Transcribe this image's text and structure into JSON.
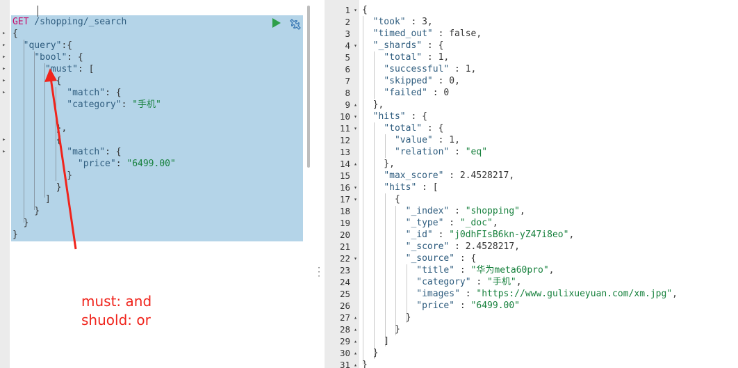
{
  "request": {
    "method": "GET",
    "url": " /shopping/_search",
    "lines": [
      [
        {
          "t": "p",
          "v": "{"
        }
      ],
      [
        {
          "t": "p",
          "v": "  "
        },
        {
          "t": "k",
          "v": "\"query\""
        },
        {
          "t": "p",
          "v": ":{"
        }
      ],
      [
        {
          "t": "p",
          "v": "    "
        },
        {
          "t": "k",
          "v": "\"bool\""
        },
        {
          "t": "p",
          "v": ": {"
        }
      ],
      [
        {
          "t": "p",
          "v": "      "
        },
        {
          "t": "k",
          "v": "\"must\""
        },
        {
          "t": "p",
          "v": ": ["
        }
      ],
      [
        {
          "t": "p",
          "v": "        {"
        }
      ],
      [
        {
          "t": "p",
          "v": "          "
        },
        {
          "t": "k",
          "v": "\"match\""
        },
        {
          "t": "p",
          "v": ": {"
        }
      ],
      [
        {
          "t": "p",
          "v": "          "
        },
        {
          "t": "k",
          "v": "\"category\""
        },
        {
          "t": "p",
          "v": ": "
        },
        {
          "t": "s",
          "v": "\"手机\""
        }
      ],
      [
        {
          "t": "p",
          "v": ""
        }
      ],
      [
        {
          "t": "p",
          "v": "        },"
        }
      ],
      [
        {
          "t": "p",
          "v": "        {"
        }
      ],
      [
        {
          "t": "p",
          "v": "          "
        },
        {
          "t": "k",
          "v": "\"match\""
        },
        {
          "t": "p",
          "v": ": {"
        }
      ],
      [
        {
          "t": "p",
          "v": "            "
        },
        {
          "t": "k",
          "v": "\"price\""
        },
        {
          "t": "p",
          "v": ": "
        },
        {
          "t": "s",
          "v": "\"6499.00\""
        }
      ],
      [
        {
          "t": "p",
          "v": "          }"
        }
      ],
      [
        {
          "t": "p",
          "v": "        }"
        }
      ],
      [
        {
          "t": "p",
          "v": "      ]"
        }
      ],
      [
        {
          "t": "p",
          "v": "    }"
        }
      ],
      [
        {
          "t": "p",
          "v": "  }"
        }
      ],
      [
        {
          "t": "p",
          "v": "}"
        }
      ]
    ]
  },
  "annotation": {
    "line1": "must: and",
    "line2": "shuold: or"
  },
  "response": {
    "lines": [
      {
        "n": "1",
        "f": "▾",
        "seg": [
          {
            "t": "p",
            "v": "{"
          }
        ]
      },
      {
        "n": "2",
        "f": "",
        "seg": [
          {
            "t": "p",
            "v": "  "
          },
          {
            "t": "k",
            "v": "\"took\""
          },
          {
            "t": "p",
            "v": " : 3,"
          }
        ]
      },
      {
        "n": "3",
        "f": "",
        "seg": [
          {
            "t": "p",
            "v": "  "
          },
          {
            "t": "k",
            "v": "\"timed_out\""
          },
          {
            "t": "p",
            "v": " : false,"
          }
        ]
      },
      {
        "n": "4",
        "f": "▾",
        "seg": [
          {
            "t": "p",
            "v": "  "
          },
          {
            "t": "k",
            "v": "\"_shards\""
          },
          {
            "t": "p",
            "v": " : {"
          }
        ]
      },
      {
        "n": "5",
        "f": "",
        "seg": [
          {
            "t": "p",
            "v": "    "
          },
          {
            "t": "k",
            "v": "\"total\""
          },
          {
            "t": "p",
            "v": " : 1,"
          }
        ]
      },
      {
        "n": "6",
        "f": "",
        "seg": [
          {
            "t": "p",
            "v": "    "
          },
          {
            "t": "k",
            "v": "\"successful\""
          },
          {
            "t": "p",
            "v": " : 1,"
          }
        ]
      },
      {
        "n": "7",
        "f": "",
        "seg": [
          {
            "t": "p",
            "v": "    "
          },
          {
            "t": "k",
            "v": "\"skipped\""
          },
          {
            "t": "p",
            "v": " : 0,"
          }
        ]
      },
      {
        "n": "8",
        "f": "",
        "seg": [
          {
            "t": "p",
            "v": "    "
          },
          {
            "t": "k",
            "v": "\"failed\""
          },
          {
            "t": "p",
            "v": " : 0"
          }
        ]
      },
      {
        "n": "9",
        "f": "▴",
        "seg": [
          {
            "t": "p",
            "v": "  },"
          }
        ]
      },
      {
        "n": "10",
        "f": "▾",
        "seg": [
          {
            "t": "p",
            "v": "  "
          },
          {
            "t": "k",
            "v": "\"hits\""
          },
          {
            "t": "p",
            "v": " : {"
          }
        ]
      },
      {
        "n": "11",
        "f": "▾",
        "seg": [
          {
            "t": "p",
            "v": "    "
          },
          {
            "t": "k",
            "v": "\"total\""
          },
          {
            "t": "p",
            "v": " : {"
          }
        ]
      },
      {
        "n": "12",
        "f": "",
        "seg": [
          {
            "t": "p",
            "v": "      "
          },
          {
            "t": "k",
            "v": "\"value\""
          },
          {
            "t": "p",
            "v": " : 1,"
          }
        ]
      },
      {
        "n": "13",
        "f": "",
        "seg": [
          {
            "t": "p",
            "v": "      "
          },
          {
            "t": "k",
            "v": "\"relation\""
          },
          {
            "t": "p",
            "v": " : "
          },
          {
            "t": "s",
            "v": "\"eq\""
          }
        ]
      },
      {
        "n": "14",
        "f": "▴",
        "seg": [
          {
            "t": "p",
            "v": "    },"
          }
        ]
      },
      {
        "n": "15",
        "f": "",
        "seg": [
          {
            "t": "p",
            "v": "    "
          },
          {
            "t": "k",
            "v": "\"max_score\""
          },
          {
            "t": "p",
            "v": " : 2.4528217,"
          }
        ]
      },
      {
        "n": "16",
        "f": "▾",
        "seg": [
          {
            "t": "p",
            "v": "    "
          },
          {
            "t": "k",
            "v": "\"hits\""
          },
          {
            "t": "p",
            "v": " : ["
          }
        ]
      },
      {
        "n": "17",
        "f": "▾",
        "seg": [
          {
            "t": "p",
            "v": "      {"
          }
        ]
      },
      {
        "n": "18",
        "f": "",
        "seg": [
          {
            "t": "p",
            "v": "        "
          },
          {
            "t": "k",
            "v": "\"_index\""
          },
          {
            "t": "p",
            "v": " : "
          },
          {
            "t": "s",
            "v": "\"shopping\""
          },
          {
            "t": "p",
            "v": ","
          }
        ]
      },
      {
        "n": "19",
        "f": "",
        "seg": [
          {
            "t": "p",
            "v": "        "
          },
          {
            "t": "k",
            "v": "\"_type\""
          },
          {
            "t": "p",
            "v": " : "
          },
          {
            "t": "s",
            "v": "\"_doc\""
          },
          {
            "t": "p",
            "v": ","
          }
        ]
      },
      {
        "n": "20",
        "f": "",
        "seg": [
          {
            "t": "p",
            "v": "        "
          },
          {
            "t": "k",
            "v": "\"_id\""
          },
          {
            "t": "p",
            "v": " : "
          },
          {
            "t": "s",
            "v": "\"j0dhFIsB6kn-yZ47i8eo\""
          },
          {
            "t": "p",
            "v": ","
          }
        ]
      },
      {
        "n": "21",
        "f": "",
        "seg": [
          {
            "t": "p",
            "v": "        "
          },
          {
            "t": "k",
            "v": "\"_score\""
          },
          {
            "t": "p",
            "v": " : 2.4528217,"
          }
        ]
      },
      {
        "n": "22",
        "f": "▾",
        "seg": [
          {
            "t": "p",
            "v": "        "
          },
          {
            "t": "k",
            "v": "\"_source\""
          },
          {
            "t": "p",
            "v": " : {"
          }
        ]
      },
      {
        "n": "23",
        "f": "",
        "seg": [
          {
            "t": "p",
            "v": "          "
          },
          {
            "t": "k",
            "v": "\"title\""
          },
          {
            "t": "p",
            "v": " : "
          },
          {
            "t": "s",
            "v": "\"华为meta60pro\""
          },
          {
            "t": "p",
            "v": ","
          }
        ]
      },
      {
        "n": "24",
        "f": "",
        "seg": [
          {
            "t": "p",
            "v": "          "
          },
          {
            "t": "k",
            "v": "\"category\""
          },
          {
            "t": "p",
            "v": " : "
          },
          {
            "t": "s",
            "v": "\"手机\""
          },
          {
            "t": "p",
            "v": ","
          }
        ]
      },
      {
        "n": "25",
        "f": "",
        "seg": [
          {
            "t": "p",
            "v": "          "
          },
          {
            "t": "k",
            "v": "\"images\""
          },
          {
            "t": "p",
            "v": " : "
          },
          {
            "t": "s",
            "v": "\"https://www.gulixueyuan.com/xm.jpg\""
          },
          {
            "t": "p",
            "v": ","
          }
        ]
      },
      {
        "n": "26",
        "f": "",
        "seg": [
          {
            "t": "p",
            "v": "          "
          },
          {
            "t": "k",
            "v": "\"price\""
          },
          {
            "t": "p",
            "v": " : "
          },
          {
            "t": "s",
            "v": "\"6499.00\""
          }
        ]
      },
      {
        "n": "27",
        "f": "▴",
        "seg": [
          {
            "t": "p",
            "v": "        }"
          }
        ]
      },
      {
        "n": "28",
        "f": "▴",
        "seg": [
          {
            "t": "p",
            "v": "      }"
          }
        ]
      },
      {
        "n": "29",
        "f": "▴",
        "seg": [
          {
            "t": "p",
            "v": "    ]"
          }
        ]
      },
      {
        "n": "30",
        "f": "▴",
        "seg": [
          {
            "t": "p",
            "v": "  }"
          }
        ]
      },
      {
        "n": "31",
        "f": "▴",
        "seg": [
          {
            "t": "p",
            "v": "}"
          }
        ]
      }
    ]
  },
  "colors": {
    "selection": "#b4d4e8",
    "method": "#c80a68",
    "key": "#2e5c7e",
    "string": "#16803c",
    "annotation": "#f0241c",
    "run_button": "#2e9f4a"
  },
  "icons": {
    "run": "play-triangle-icon",
    "settings": "wrench-icon",
    "resize": "vertical-dots-icon"
  }
}
